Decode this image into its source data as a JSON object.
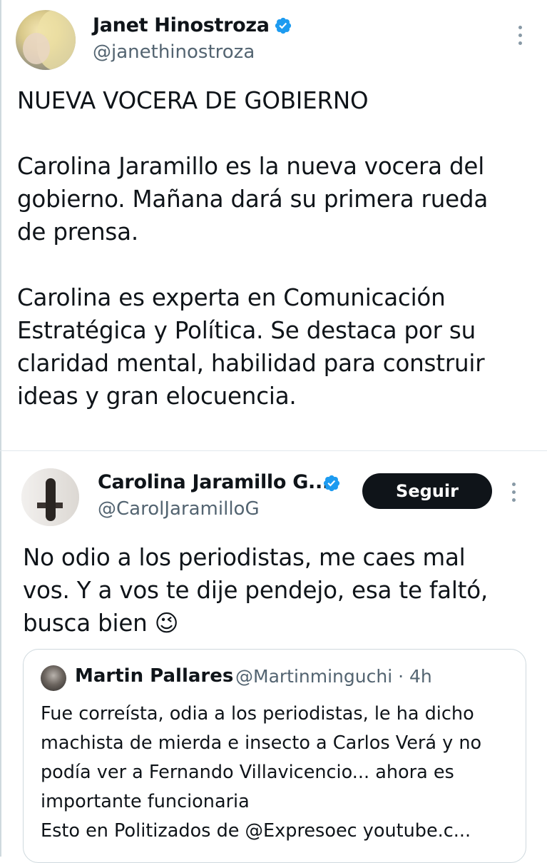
{
  "tweet1": {
    "author_name": "Janet Hinostroza",
    "author_handle": "@janethinostroza",
    "lines": [
      "NUEVA VOCERA DE GOBIERNO",
      "",
      "Carolina Jaramillo es la nueva vocera del",
      "gobierno.  Mañana dará su primera rueda",
      "de prensa.",
      "",
      "Carolina es experta en Comunicación",
      "Estratégica y Política. Se destaca por su",
      "claridad mental, habilidad para construir",
      "ideas y gran elocuencia."
    ]
  },
  "tweet2": {
    "author_name": "Carolina Jaramillo G...",
    "author_handle": "@CarolJaramilloG",
    "follow_label": "Seguir",
    "lines": [
      "No odio a los periodistas, me caes mal",
      "vos. Y a vos te dije pendejo, esa te faltó,",
      "busca bien"
    ],
    "emoji": "😉",
    "quoted": {
      "author_name": "Martin Pallares",
      "author_handle_time": "@Martinminguchi · 4h",
      "lines": [
        "Fue correísta, odia a los periodistas, le ha dicho",
        "machista de mierda e insecto a Carlos Verá y no",
        "podía ver a  Fernando Villavicencio... ahora es",
        "importante funcionaria",
        "Esto en Politizados de @Expresoec  youtube.c..."
      ]
    }
  },
  "colors": {
    "verified_blue": "#1d9bf0",
    "text_primary": "#0f1419",
    "text_secondary": "#536471",
    "follow_button_bg": "#0f1419"
  },
  "icons": {
    "verified": "verified-badge-icon",
    "more": "more-options-icon"
  }
}
